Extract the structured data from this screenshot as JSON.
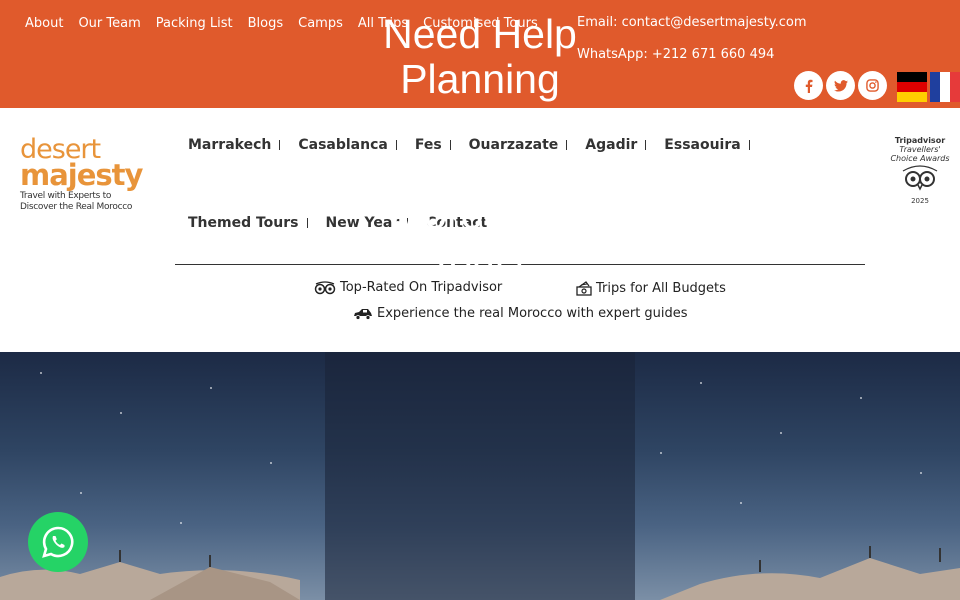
{
  "topbar": {
    "nav": [
      "About",
      "Our Team",
      "Packing List",
      "Blogs",
      "Camps",
      "All Trips",
      "Customised Tours"
    ],
    "email": "Email: contact@desertmajesty.com",
    "phone": "WhatsApp: +212 671 660 494",
    "socials": [
      {
        "icon": "facebook-icon",
        "glyph": "f"
      },
      {
        "icon": "twitter-icon",
        "glyph": "t"
      },
      {
        "icon": "instagram-icon",
        "glyph": "◎"
      }
    ],
    "colors": {
      "accent": "#e05a2c"
    }
  },
  "logo": {
    "word1": "desert",
    "word2": "majesty",
    "tagline_line1": "Travel with Experts to",
    "tagline_line2": "Discover the Real Morocco"
  },
  "nav": {
    "row1": [
      "Marrakech",
      "Casablanca",
      "Fes",
      "Ouarzazate",
      "Agadir",
      "Essaouira"
    ],
    "row2": [
      "Themed Tours",
      "New Year",
      "Contact"
    ]
  },
  "award": {
    "line1": "Tripadvisor",
    "line2": "Travellers'",
    "line3": "Choice Awards",
    "year": "2025"
  },
  "features": {
    "tripadvisor": "Top-Rated On Tripadvisor",
    "budgets": "Trips for All Budgets",
    "guides": "Experience the real Morocco with expert guides"
  },
  "hero": {
    "title_lines": [
      "Need Help",
      "Planning",
      "Your",
      "Luxury",
      "Moroccan",
      "Tour?"
    ]
  }
}
